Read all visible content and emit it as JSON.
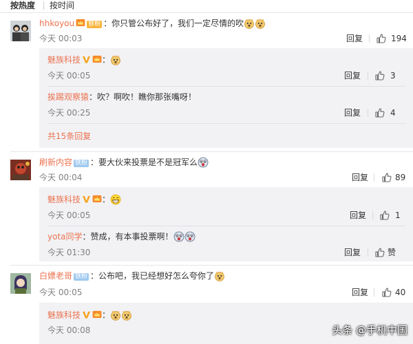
{
  "sort_tabs": {
    "hot": "按热度",
    "time": "按时间"
  },
  "comments": [
    {
      "author": "hhkoyou",
      "badge": "铁粉",
      "text": "：你只管公布好了，我们一定尽情的吹",
      "time": "今天 00:03",
      "reply_label": "回复",
      "likes": "194",
      "replies": [
        {
          "author": "魅族科技",
          "text": "：",
          "time": "今天 00:05",
          "reply_label": "回复",
          "likes": "3"
        },
        {
          "author": "挨踢观察猿",
          "text": "：吹？啊吹！瞧你那张嘴呀！",
          "time": "今天 00:25",
          "reply_label": "回复",
          "likes": "4"
        }
      ],
      "more_replies": "共15条回复"
    },
    {
      "author": "刷新内容",
      "badge": "铁粉",
      "text": "：要大伙来投票是不是冠军么",
      "time": "今天 00:04",
      "reply_label": "回复",
      "likes": "89",
      "replies": [
        {
          "author": "魅族科技",
          "text": "：",
          "time": "今天 00:05",
          "reply_label": "回复",
          "likes": "1"
        },
        {
          "author": "yota同学",
          "text": "：赞成，有本事投票啊！",
          "time": "今天 01:30",
          "reply_label": "回复",
          "likes": "赞"
        }
      ]
    },
    {
      "author": "白嫖老哥",
      "badge": "铁粉",
      "text": "：公布吧，我已经想好怎么夸你了",
      "time": "今天 00:05",
      "reply_label": "回复",
      "likes": "40",
      "replies": [
        {
          "author": "魅族科技",
          "text": "：",
          "time": "今天 00:08",
          "reply_label": "回复",
          "likes": ""
        }
      ]
    }
  ],
  "watermark": "头条 @手机中国",
  "colors": {
    "link": "#eb7350",
    "reply_bg": "#f2f2f5",
    "meta": "#808080"
  },
  "icons": [
    "thumb-up-icon",
    "verified-v-icon",
    "doge-emoji",
    "grin-emoji",
    "shock-emoji",
    "avatar-image"
  ]
}
